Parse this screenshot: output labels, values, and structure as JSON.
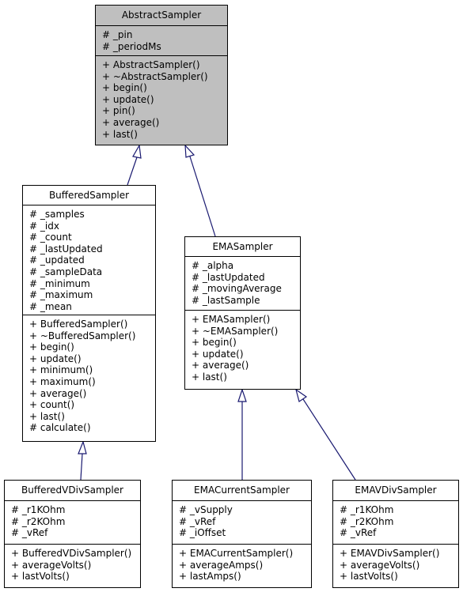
{
  "diagram": {
    "type": "class-inheritance",
    "edge_color": "#191970",
    "base_fill": "#bfbfbf",
    "classes": {
      "abstract_sampler": {
        "name": "AbstractSampler",
        "attributes": [
          "# _pin",
          "# _periodMs"
        ],
        "methods": [
          "+ AbstractSampler()",
          "+ ~AbstractSampler()",
          "+ begin()",
          "+ update()",
          "+ pin()",
          "+ average()",
          "+ last()"
        ]
      },
      "buffered_sampler": {
        "name": "BufferedSampler",
        "attributes": [
          "# _samples",
          "# _idx",
          "# _count",
          "# _lastUpdated",
          "# _updated",
          "# _sampleData",
          "# _minimum",
          "# _maximum",
          "# _mean"
        ],
        "methods": [
          "+ BufferedSampler()",
          "+ ~BufferedSampler()",
          "+ begin()",
          "+ update()",
          "+ minimum()",
          "+ maximum()",
          "+ average()",
          "+ count()",
          "+ last()",
          "# calculate()"
        ]
      },
      "ema_sampler": {
        "name": "EMASampler",
        "attributes": [
          "# _alpha",
          "# _lastUpdated",
          "# _movingAverage",
          "# _lastSample"
        ],
        "methods": [
          "+ EMASampler()",
          "+ ~EMASampler()",
          "+ begin()",
          "+ update()",
          "+ average()",
          "+ last()"
        ]
      },
      "buffered_vdiv_sampler": {
        "name": "BufferedVDivSampler",
        "attributes": [
          "# _r1KOhm",
          "# _r2KOhm",
          "# _vRef"
        ],
        "methods": [
          "+ BufferedVDivSampler()",
          "+ averageVolts()",
          "+ lastVolts()"
        ]
      },
      "ema_current_sampler": {
        "name": "EMACurrentSampler",
        "attributes": [
          "# _vSupply",
          "# _vRef",
          "# _iOffset"
        ],
        "methods": [
          "+ EMACurrentSampler()",
          "+ averageAmps()",
          "+ lastAmps()"
        ]
      },
      "ema_vdiv_sampler": {
        "name": "EMAVDivSampler",
        "attributes": [
          "# _r1KOhm",
          "# _r2KOhm",
          "# _vRef"
        ],
        "methods": [
          "+ EMAVDivSampler()",
          "+ averageVolts()",
          "+ lastVolts()"
        ]
      }
    },
    "inheritance": [
      {
        "child": "BufferedSampler",
        "parent": "AbstractSampler"
      },
      {
        "child": "EMASampler",
        "parent": "AbstractSampler"
      },
      {
        "child": "BufferedVDivSampler",
        "parent": "BufferedSampler"
      },
      {
        "child": "EMACurrentSampler",
        "parent": "EMASampler"
      },
      {
        "child": "EMAVDivSampler",
        "parent": "EMASampler"
      }
    ]
  }
}
